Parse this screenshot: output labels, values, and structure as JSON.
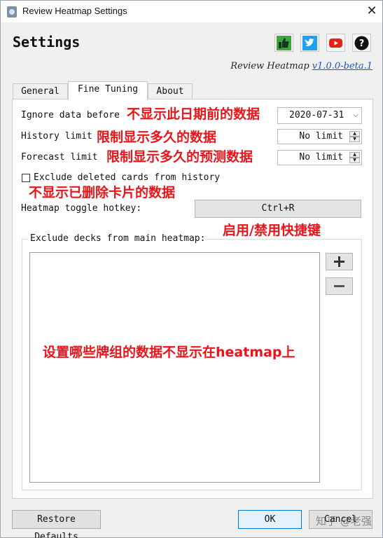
{
  "window": {
    "title": "Review Heatmap Settings",
    "close_glyph": "✕"
  },
  "header": {
    "title": "Settings",
    "social_icons": [
      {
        "name": "like-icon",
        "color": "#4caf50"
      },
      {
        "name": "twitter-icon",
        "color": "#1da1f2"
      },
      {
        "name": "youtube-icon",
        "color": "#e62117"
      },
      {
        "name": "help-icon",
        "color": "#111111"
      }
    ],
    "app_name": "Review Heatmap",
    "version": "v1.0.0-beta.1"
  },
  "tabs": [
    {
      "label": "General",
      "active": false
    },
    {
      "label": "Fine Tuning",
      "active": true
    },
    {
      "label": "About",
      "active": false
    }
  ],
  "fine_tuning": {
    "ignore_label": "Ignore data before",
    "ignore_value": "2020-07-31",
    "history_label": "History limit",
    "history_value": "No limit",
    "forecast_label": "Forecast limit",
    "forecast_value": "No limit",
    "exclude_deleted_label": "Exclude deleted cards from history",
    "exclude_deleted_checked": false,
    "hotkey_label": "Heatmap toggle hotkey:",
    "hotkey_value": "Ctrl+R",
    "exclude_decks_title": "Exclude decks from main heatmap:",
    "add_glyph": "+",
    "remove_glyph": "−"
  },
  "footer": {
    "restore_label": "Restore Defaults",
    "ok_label": "OK",
    "cancel_label": "Cancel"
  },
  "annotations": {
    "ignore_note": "不显示此日期前的数据",
    "history_note": "限制显示多久的数据",
    "forecast_note": "限制显示多久的预测数据",
    "deleted_note": "不显示已删除卡片的数据",
    "hotkey_note": "启用/禁用快捷键",
    "decks_note": "设置哪些牌组的数据不显示在heatmap上"
  },
  "watermark": "知乎 @老强",
  "colors": {
    "annotation": "#e8151b",
    "link": "#1a55c8",
    "ok_border": "#0078d7"
  }
}
